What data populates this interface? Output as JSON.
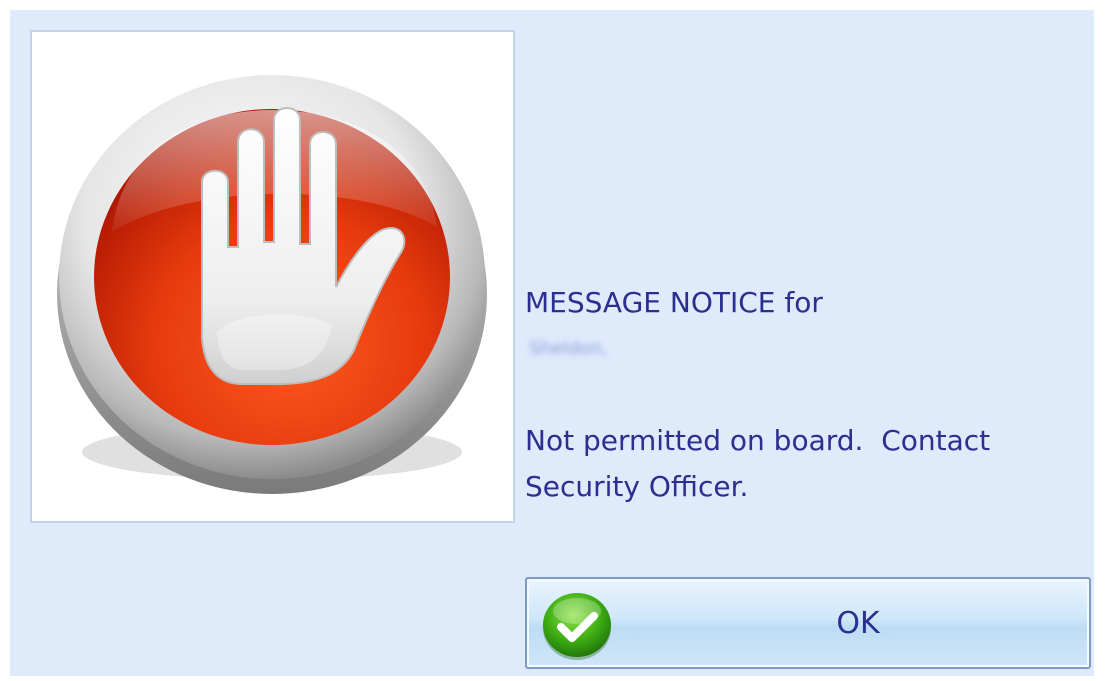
{
  "dialog": {
    "image": {
      "icon": "stop-hand-icon"
    },
    "message": {
      "heading": "MESSAGE NOTICE for",
      "recipient": "Sheldon,",
      "body_line1": "Not permitted on board.  Contact",
      "body_line2": "Security Officer."
    },
    "ok_button": {
      "label": "OK",
      "icon": "green-checkmark-icon"
    }
  }
}
